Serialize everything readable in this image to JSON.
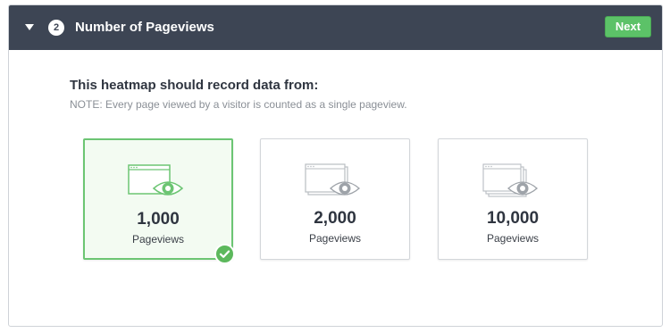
{
  "step": {
    "number": "2",
    "title": "Number of Pageviews",
    "next_label": "Next"
  },
  "content": {
    "heading": "This heatmap should record data from:",
    "note": "NOTE: Every page viewed by a visitor is counted as a single pageview."
  },
  "options": [
    {
      "value": "1,000",
      "label": "Pageviews",
      "selected": true,
      "icon": "single-page-eye-icon"
    },
    {
      "value": "2,000",
      "label": "Pageviews",
      "selected": false,
      "icon": "double-page-eye-icon"
    },
    {
      "value": "10,000",
      "label": "Pageviews",
      "selected": false,
      "icon": "stacked-pages-eye-icon"
    }
  ],
  "colors": {
    "header_bg": "#3d4554",
    "accent_green": "#5cc268",
    "selected_border": "#6cc573",
    "selected_bg": "#f3fbf2"
  }
}
